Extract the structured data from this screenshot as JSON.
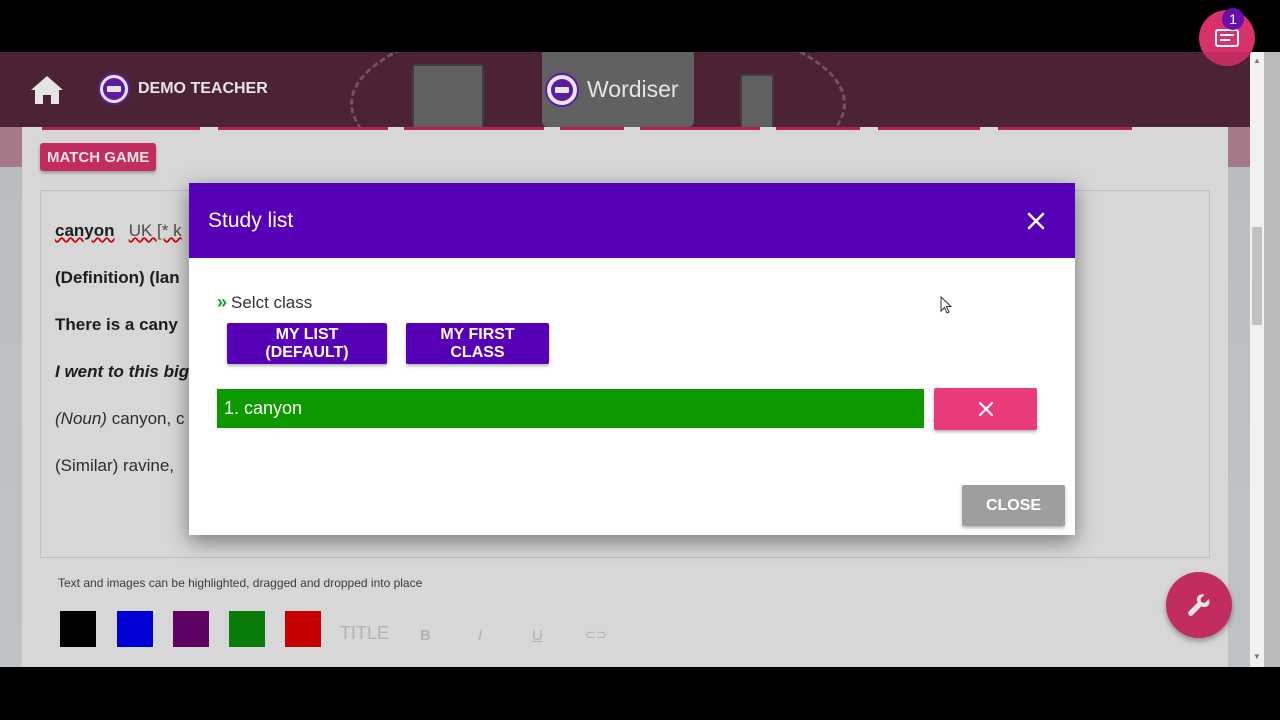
{
  "header": {
    "user_name": "DEMO TEACHER",
    "brand_name": "Wordiser",
    "notification_count": "1"
  },
  "page": {
    "match_game_label": "MATCH GAME",
    "doc_lines": {
      "word": "canyon",
      "pron": "UK [* k",
      "definition": "(Definition) (lan",
      "example1": "There is a cany",
      "example2": "I went to this big",
      "noun_tag": "(Noun)",
      "noun_rest": " canyon, c",
      "similar": "(Similar) ravine,"
    },
    "hint": "Text and images can be highlighted, dragged and dropped into place",
    "toolbar": {
      "title_label": "TITLE",
      "bold_label": "B",
      "italic_label": "I",
      "underline_label": "U",
      "link_label": "⊂⊃"
    },
    "swatch_colors": [
      "#000000",
      "#0000ee",
      "#6a006f",
      "#0a8a0a",
      "#dd0000"
    ]
  },
  "dialog": {
    "title": "Study list",
    "select_label": "Selct class",
    "class_buttons": [
      "MY LIST (DEFAULT)",
      "MY FIRST CLASS"
    ],
    "word_entry": "1. canyon",
    "close_label": "CLOSE"
  },
  "colors": {
    "dialog_header": "#5600b8",
    "accent_pink": "#d8316b",
    "word_green": "#0c9a00"
  }
}
